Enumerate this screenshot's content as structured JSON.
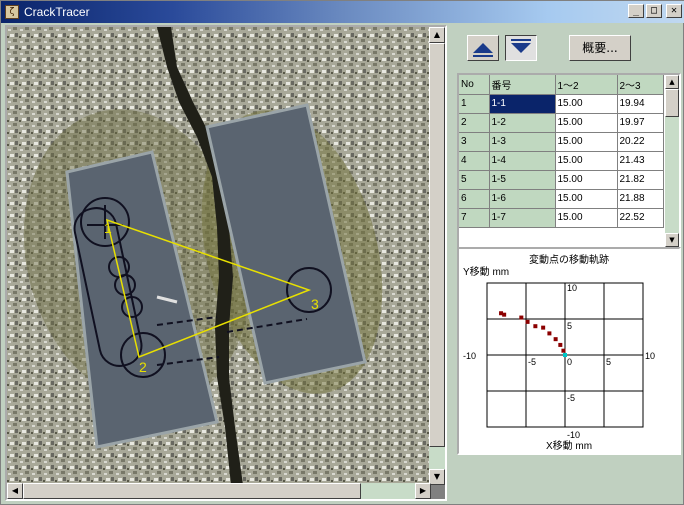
{
  "window": {
    "title": "CrackTracer",
    "app_icon": "ζ",
    "min_glyph": "_",
    "max_glyph": "□",
    "close_glyph": "✕"
  },
  "image": {
    "markers": [
      "1",
      "2",
      "3"
    ]
  },
  "side": {
    "up_button_icon": "up-triangle",
    "down_button_icon": "down-triangle",
    "summary_label": "概要..."
  },
  "table": {
    "headers": [
      "No",
      "番号",
      "1〜2",
      "2〜3"
    ],
    "rows": [
      [
        "1",
        "1-1",
        "15.00",
        "19.94"
      ],
      [
        "2",
        "1-2",
        "15.00",
        "19.97"
      ],
      [
        "3",
        "1-3",
        "15.00",
        "20.22"
      ],
      [
        "4",
        "1-4",
        "15.00",
        "21.43"
      ],
      [
        "5",
        "1-5",
        "15.00",
        "21.82"
      ],
      [
        "6",
        "1-6",
        "15.00",
        "21.88"
      ],
      [
        "7",
        "1-7",
        "15.00",
        "22.52"
      ]
    ],
    "selected_row": 0
  },
  "chart_data": {
    "type": "scatter",
    "title": "変動点の移動軌跡",
    "xlabel": "X移動 mm",
    "ylabel": "Y移動 mm",
    "xlim": [
      -10,
      10
    ],
    "ylim": [
      -10,
      10
    ],
    "xticks": [
      "-10",
      "-5",
      "0",
      "5",
      "10"
    ],
    "yticks": [
      "10",
      "5",
      "-5",
      "-10"
    ],
    "grid": true,
    "points": [
      {
        "x": -8.2,
        "y": 5.8
      },
      {
        "x": -7.8,
        "y": 5.6
      },
      {
        "x": -5.6,
        "y": 5.2
      },
      {
        "x": -4.8,
        "y": 4.6
      },
      {
        "x": -3.8,
        "y": 4.0
      },
      {
        "x": -2.8,
        "y": 3.8
      },
      {
        "x": -2.0,
        "y": 3.0
      },
      {
        "x": -1.2,
        "y": 2.2
      },
      {
        "x": -0.6,
        "y": 1.4
      },
      {
        "x": -0.2,
        "y": 0.6
      },
      {
        "x": 0,
        "y": 0
      }
    ],
    "point_color": "#8b0000",
    "origin_color": "#00c8c8"
  }
}
